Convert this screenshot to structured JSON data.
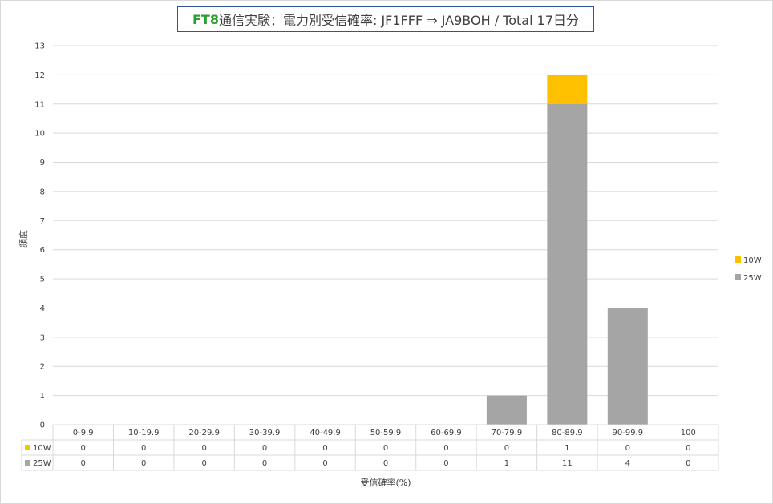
{
  "title": {
    "prefix": "FT8",
    "rest": "通信実験：電力別受信確率: JF1FFF ⇒ JA9BOH / Total 17日分"
  },
  "colors": {
    "10W": "#ffc000",
    "25W": "#a5a5a5",
    "title_prefix": "#2ca02c",
    "title_border": "#2f5597"
  },
  "chart_data": {
    "type": "bar",
    "stacked": true,
    "categories": [
      "0-9.9",
      "10-19.9",
      "20-29.9",
      "30-39.9",
      "40-49.9",
      "50-59.9",
      "60-69.9",
      "70-79.9",
      "80-89.9",
      "90-99.9",
      "100"
    ],
    "series": [
      {
        "name": "10W",
        "values": [
          0,
          0,
          0,
          0,
          0,
          0,
          0,
          0,
          1,
          0,
          0
        ]
      },
      {
        "name": "25W",
        "values": [
          0,
          0,
          0,
          0,
          0,
          0,
          0,
          1,
          11,
          4,
          0
        ]
      }
    ],
    "ylabel": "頻度",
    "xlabel": "受信確率(%)",
    "ylim": [
      0,
      13
    ],
    "yticks": [
      0,
      1,
      2,
      3,
      4,
      5,
      6,
      7,
      8,
      9,
      10,
      11,
      12,
      13
    ],
    "grid": true,
    "legend": "right",
    "data_table": true
  }
}
